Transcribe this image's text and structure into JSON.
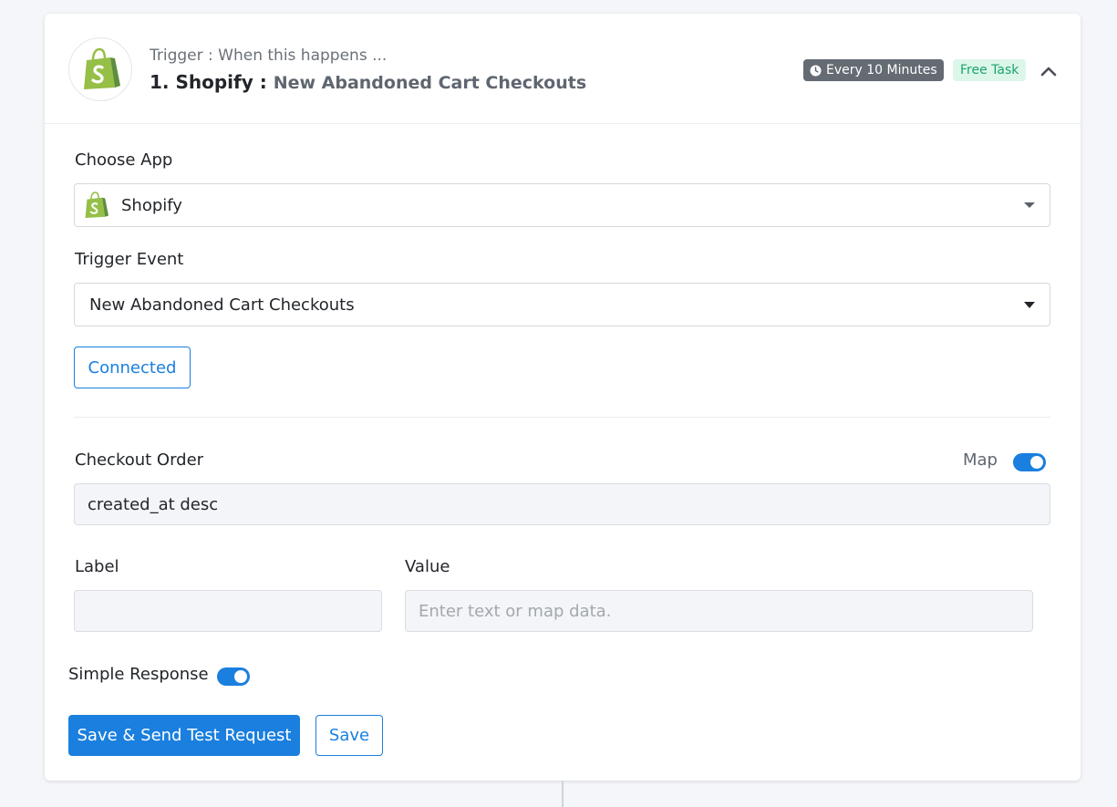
{
  "header": {
    "subtitle": "Trigger : When this happens ...",
    "step_prefix": "1. Shopify : ",
    "event_name": "New Abandoned Cart Checkouts",
    "interval_badge": "Every 10 Minutes",
    "task_badge": "Free Task",
    "icons": {
      "app": "shopify-logo-icon",
      "clock": "clock-icon",
      "collapse": "chevron-up-icon"
    }
  },
  "form": {
    "choose_app": {
      "label": "Choose App",
      "value": "Shopify"
    },
    "trigger_event": {
      "label": "Trigger Event",
      "value": "New Abandoned Cart Checkouts"
    },
    "connected_button": "Connected",
    "checkout_order": {
      "label": "Checkout Order",
      "map_label": "Map",
      "map_enabled": true,
      "value": "created_at desc"
    },
    "label_field": {
      "label": "Label",
      "value": ""
    },
    "value_field": {
      "label": "Value",
      "placeholder": "Enter text or map data."
    },
    "simple_response": {
      "label": "Simple Response",
      "enabled": true
    }
  },
  "actions": {
    "save_send_label": "Save & Send Test Request",
    "save_label": "Save"
  },
  "colors": {
    "accent": "#1a7fde",
    "shopify_green": "#95bf47",
    "free_badge_bg": "#dcf6ea",
    "free_badge_text": "#1ea36a",
    "interval_badge_bg": "#646b73"
  }
}
